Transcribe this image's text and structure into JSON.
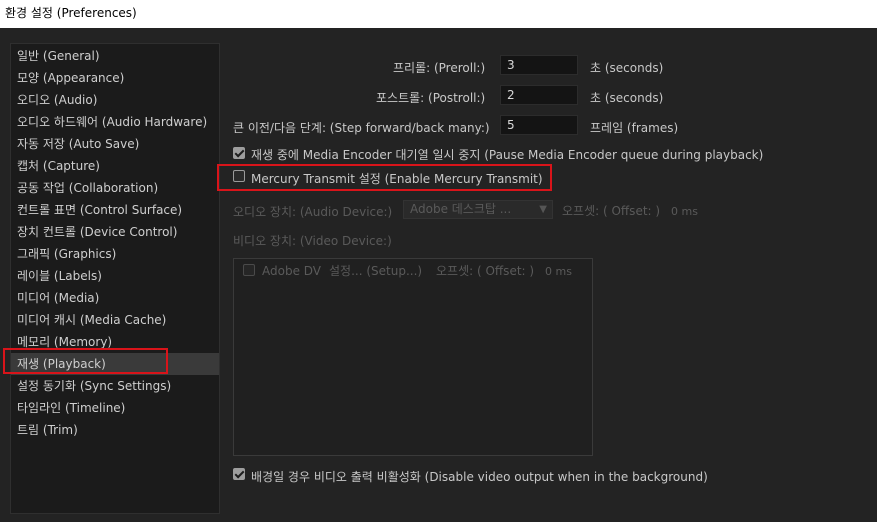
{
  "window": {
    "title": "환경 설정 (Preferences)"
  },
  "sidebar": {
    "items": [
      {
        "label": "일반 (General)"
      },
      {
        "label": "모양 (Appearance)"
      },
      {
        "label": "오디오 (Audio)"
      },
      {
        "label": "오디오 하드웨어 (Audio Hardware)"
      },
      {
        "label": "자동 저장 (Auto Save)"
      },
      {
        "label": "캡처 (Capture)"
      },
      {
        "label": "공동 작업 (Collaboration)"
      },
      {
        "label": "컨트롤 표면 (Control Surface)"
      },
      {
        "label": "장치 컨트롤 (Device Control)"
      },
      {
        "label": "그래픽 (Graphics)"
      },
      {
        "label": "레이블 (Labels)"
      },
      {
        "label": "미디어 (Media)"
      },
      {
        "label": "미디어 캐시 (Media Cache)"
      },
      {
        "label": "메모리 (Memory)"
      },
      {
        "label": "재생 (Playback)"
      },
      {
        "label": "설정 동기화 (Sync Settings)"
      },
      {
        "label": "타임라인 (Timeline)"
      },
      {
        "label": "트림 (Trim)"
      }
    ],
    "selected": "재생 (Playback)"
  },
  "playback": {
    "preroll": {
      "label": "프리롤: (Preroll:)",
      "value": "3",
      "unit": "초 (seconds)"
    },
    "postroll": {
      "label": "포스트롤: (Postroll:)",
      "value": "2",
      "unit": "초 (seconds)"
    },
    "step": {
      "label": "큰 이전/다음 단계: (Step forward/back many:)",
      "value": "5",
      "unit": "프레임 (frames)"
    },
    "pause_ame": {
      "label": "재생 중에 Media Encoder 대기열 일시 중지 (Pause Media Encoder queue during playback)",
      "checked": true
    },
    "mercury": {
      "label": "Mercury Transmit 설정 (Enable Mercury Transmit)",
      "checked": false
    },
    "audio_device": {
      "label": "오디오 장치: (Audio Device:)",
      "selected": "Adobe 데스크탑 ...",
      "offset_label": "오프셋: ( Offset: )",
      "offset_value": "0 ms"
    },
    "video_device": {
      "label": "비디오 장치: (Video Device:)",
      "rows": [
        {
          "name": "Adobe DV",
          "setup": "설정... (Setup...)",
          "offset_label": "오프셋: ( Offset: )",
          "offset_value": "0 ms",
          "checked": false
        }
      ]
    },
    "disable_bg": {
      "label": "배경일 경우 비디오 출력 비활성화 (Disable video output when in the background)",
      "checked": true
    }
  },
  "colors": {
    "highlight": "#d9141a",
    "background": "#232323",
    "panel": "#1b1b1b"
  }
}
